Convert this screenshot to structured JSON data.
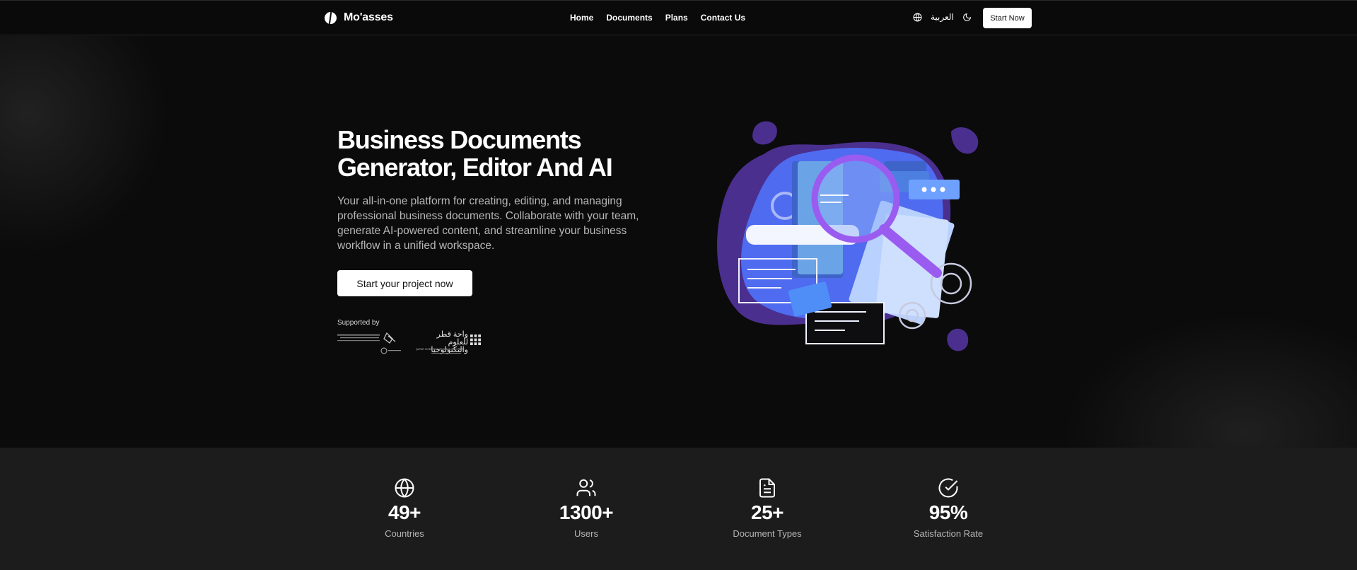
{
  "nav": {
    "brand": "Mo'asses",
    "links": [
      "Home",
      "Documents",
      "Plans",
      "Contact Us"
    ],
    "language_label": "العربية",
    "start_label": "Start Now"
  },
  "hero": {
    "title_line1": "Business Documents",
    "title_line2": "Generator, Editor And AI",
    "description": "Your all-in-one platform for creating, editing, and managing professional business documents. Collaborate with your team, generate AI-powered content, and streamline your business workflow in a unified workspace.",
    "cta_label": "Start your project now",
    "supported_label": "Supported by",
    "sponsor2_arabic": "واحة قطر للعلوم والتكنولوجيا",
    "sponsor2_english": "QATAR SCIENCE & TECHNOLOGY PARK"
  },
  "stats": [
    {
      "icon": "globe-icon",
      "value": "49+",
      "label": "Countries"
    },
    {
      "icon": "users-icon",
      "value": "1300+",
      "label": "Users"
    },
    {
      "icon": "document-icon",
      "value": "25+",
      "label": "Document Types"
    },
    {
      "icon": "check-circle-icon",
      "value": "95%",
      "label": "Satisfaction Rate"
    }
  ],
  "colors": {
    "background": "#0b0b0c",
    "stats_background": "#1c1c1d",
    "illustration_purple": "#5b3fa8",
    "illustration_blue": "#4f6bf0",
    "magnifier": "#9a5cf0"
  }
}
